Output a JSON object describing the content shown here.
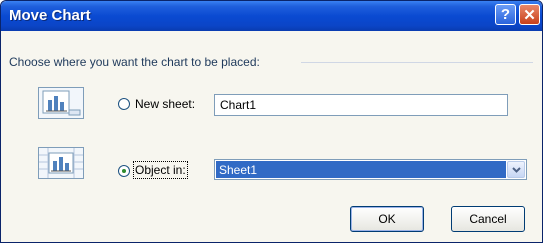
{
  "window": {
    "title": "Move Chart",
    "help_label": "?",
    "close_label": "✕"
  },
  "dialog": {
    "prompt": "Choose where you want the chart to be placed:",
    "new_sheet": {
      "label": "New sheet:",
      "selected": false,
      "value": "Chart1",
      "icon": "chart-sheet-icon"
    },
    "object_in": {
      "label": "Object in:",
      "selected": true,
      "value": "Sheet1",
      "icon": "embedded-chart-icon"
    }
  },
  "buttons": {
    "ok_label": "OK",
    "cancel_label": "Cancel"
  },
  "colors": {
    "titlebar": "#0a4ad2",
    "selection": "#316ac5",
    "dialog_bg": "#f7f6ef"
  }
}
